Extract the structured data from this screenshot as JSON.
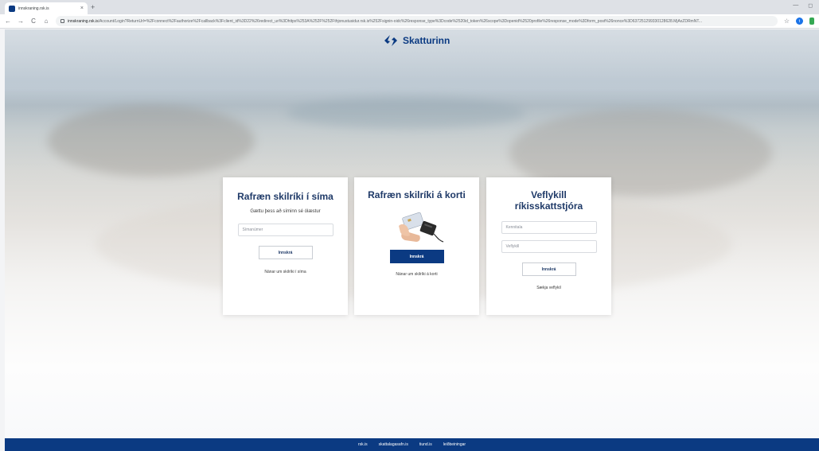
{
  "browser": {
    "tab_title": "innskraning.rsk.is",
    "tab_close": "×",
    "new_tab": "+",
    "url_host": "innskraning.rsk.is",
    "url_rest": "/Account/Login?ReturnUrl=%2Fconnect%2Fauthorize%2Fcallback%3Fclient_id%3D22%26redirect_uri%3Dhttps%253A%252F%252Fthjonustusidur.rsk.is%252Fsignin-oidc%26response_type%3Dcode%2520id_token%26scope%3Dopenid%2520profile%26response_mode%3Dform_post%26nonce%3D637251299330128628.MjAxZDRmNT...",
    "profile_initial": "t",
    "back": "←",
    "forward": "→",
    "reload": "C",
    "home": "⌂",
    "star": "☆",
    "minimize": "—",
    "restore": "◻"
  },
  "brand": {
    "name": "Skatturinn",
    "color": "#0b3a82"
  },
  "cards": {
    "phone": {
      "title": "Rafræn skilríki í síma",
      "subtitle": "Gættu þess að síminn sé ólæstur",
      "phone_placeholder": "Símanúmer",
      "login_label": "Innskrá",
      "link": "Nánar um skilríki í síma"
    },
    "card": {
      "title": "Rafræn skilríki á korti",
      "login_label": "Innskrá",
      "link": "Nánar um skilríki á korti",
      "image_icon": "card-reader-icon"
    },
    "webkey": {
      "title": "Veflykill ríkisskattstjóra",
      "kennitala_placeholder": "Kennitala",
      "veflykill_placeholder": "Veflykill",
      "login_label": "Innskrá",
      "link": "Sækja veflykil"
    }
  },
  "footer": {
    "links": [
      "rsk.is",
      "skattalagasafn.is",
      "tiund.is",
      "leiðbeiningar"
    ]
  }
}
